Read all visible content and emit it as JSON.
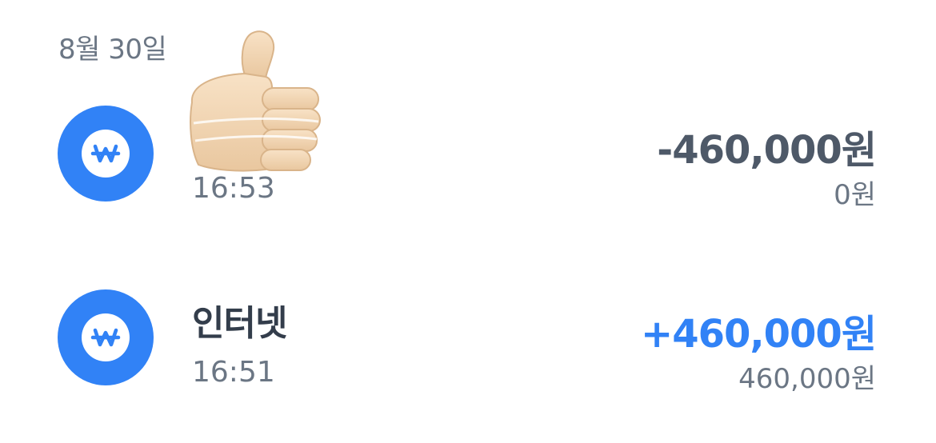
{
  "date_header": "8월 30일",
  "transactions": [
    {
      "title": "",
      "time": "16:53",
      "amount": "-460,000원",
      "balance": "0원",
      "icon": "won-icon",
      "reaction": "thumbs-up-emoji"
    },
    {
      "title": "인터넷",
      "time": "16:51",
      "amount": "+460,000원",
      "balance": "460,000원",
      "icon": "won-icon"
    }
  ],
  "colors": {
    "accent": "#3182f6",
    "amount_negative": "#4e5968",
    "secondary_text": "#6b7684",
    "title_text": "#333d4b"
  }
}
